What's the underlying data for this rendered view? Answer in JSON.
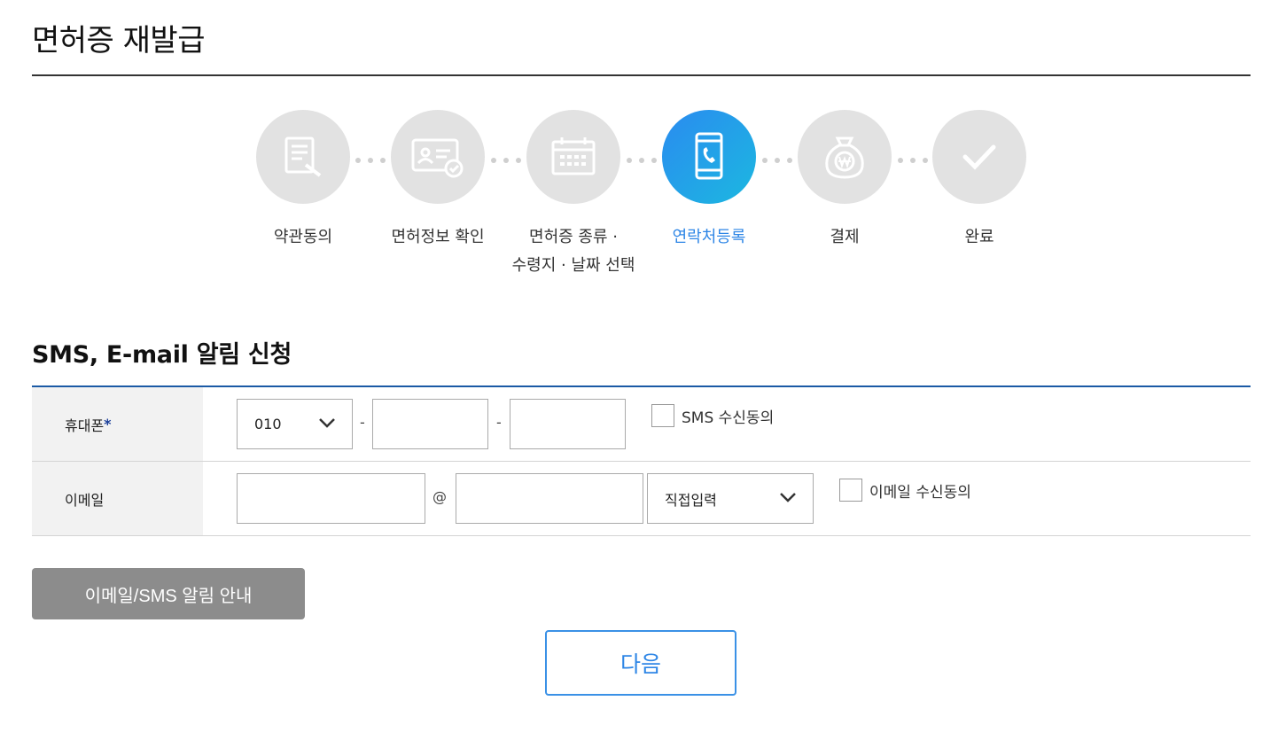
{
  "page": {
    "title": "면허증 재발급"
  },
  "steps": [
    {
      "label": "약관동의",
      "icon": "document-sign-icon",
      "active": false
    },
    {
      "label": "면허정보 확인",
      "icon": "id-card-check-icon",
      "active": false
    },
    {
      "label": "면허증 종류 ·",
      "label2": "수령지 · 날짜 선택",
      "icon": "calendar-icon",
      "active": false
    },
    {
      "label": "연락처등록",
      "icon": "mobile-phone-icon",
      "active": true
    },
    {
      "label": "결제",
      "icon": "money-bag-won-icon",
      "active": false
    },
    {
      "label": "완료",
      "icon": "checkmark-icon",
      "active": false
    }
  ],
  "section": {
    "title": "SMS, E-mail 알림 신청"
  },
  "phone": {
    "label": "휴대폰",
    "required_mark": "*",
    "prefix_selected": "010",
    "separator": "-",
    "middle_value": "",
    "last_value": "",
    "consent_label": "SMS 수신동의"
  },
  "email": {
    "label": "이메일",
    "local_value": "",
    "at_sign": "@",
    "domain_value": "",
    "domain_select": "직접입력",
    "consent_label": "이메일 수신동의"
  },
  "buttons": {
    "notice": "이메일/SMS 알림 안내",
    "next": "다음"
  },
  "colors": {
    "accent": "#2e86e6",
    "table_border": "#1b5aa5",
    "inactive_circle": "#e2e2e2",
    "notice_button": "#8c8c8c"
  }
}
